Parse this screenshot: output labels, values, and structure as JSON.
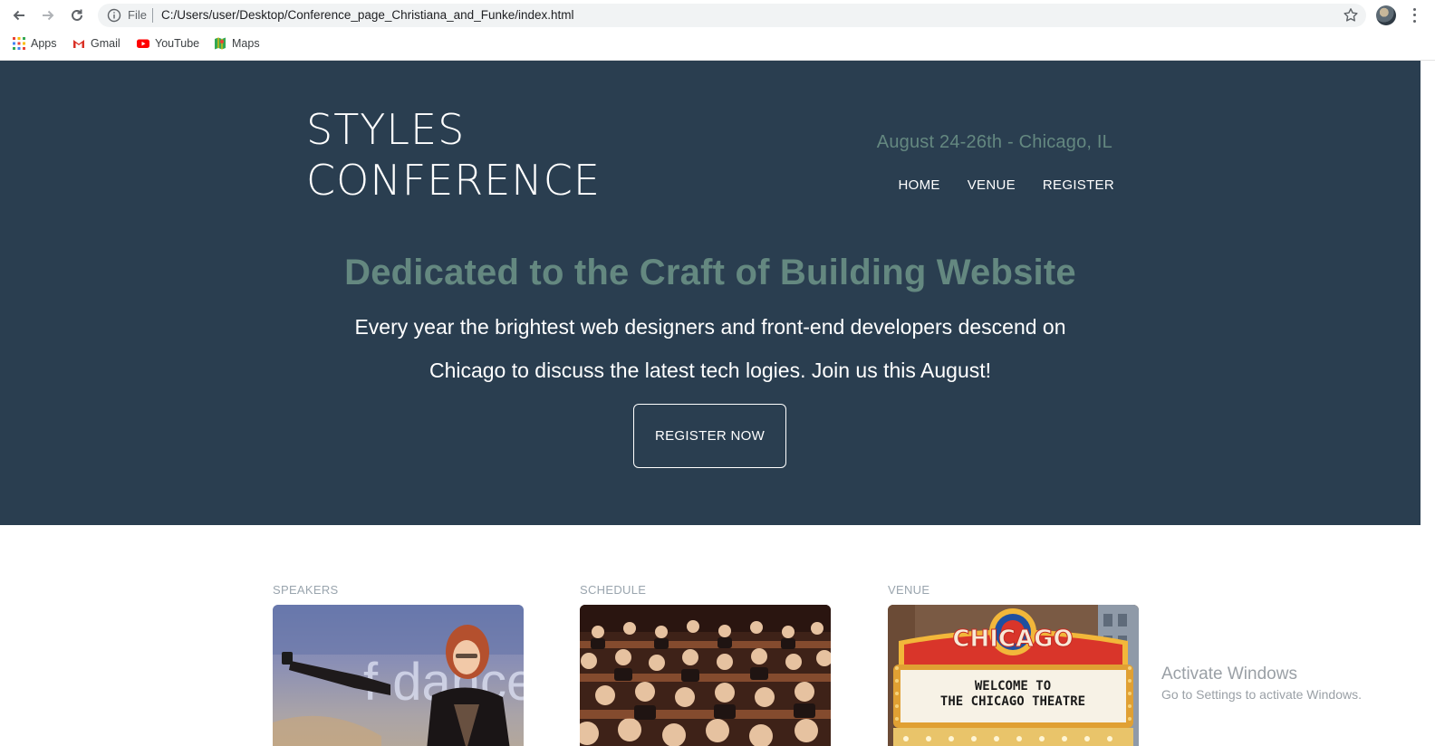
{
  "browser": {
    "omnibox": {
      "security_label": "File",
      "url": "C:/Users/user/Desktop/Conference_page_Christiana_and_Funke/index.html"
    },
    "bookmarks": [
      {
        "label": "Apps",
        "icon": "apps-grid-icon"
      },
      {
        "label": "Gmail",
        "icon": "gmail-icon"
      },
      {
        "label": "YouTube",
        "icon": "youtube-icon"
      },
      {
        "label": "Maps",
        "icon": "maps-icon"
      }
    ]
  },
  "page": {
    "brand": {
      "line1": "STYLES",
      "line2": "CONFERENCE"
    },
    "dates": "August 24-26th - Chicago, IL",
    "nav": [
      {
        "label": "HOME"
      },
      {
        "label": "VENUE"
      },
      {
        "label": "REGISTER"
      }
    ],
    "tagline": "Dedicated to the Craft of Building Website",
    "intro": "Every year the brightest web designers and front-end developers descend on Chicago to discuss the latest tech logies. Join us this August!",
    "cta_label": "REGISTER NOW",
    "teasers": [
      {
        "heading": "SPEAKERS"
      },
      {
        "heading": "SCHEDULE"
      },
      {
        "heading": "VENUE",
        "marquee_top": "CHICAGO",
        "marquee_line1": "WELCOME TO",
        "marquee_line2": "THE CHICAGO THEATRE"
      }
    ],
    "colors": {
      "hero_bg": "#2a3e50",
      "accent": "#648880"
    }
  },
  "os_watermark": {
    "title": "Activate Windows",
    "subtitle": "Go to Settings to activate Windows."
  }
}
